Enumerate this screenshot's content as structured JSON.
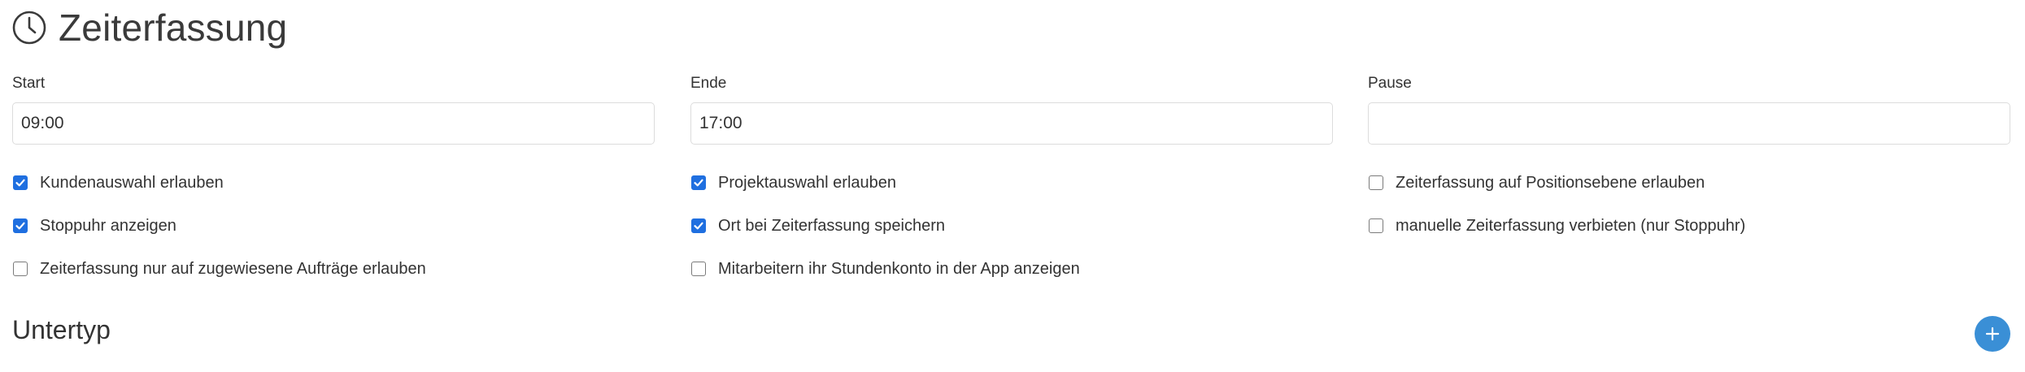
{
  "header": {
    "title": "Zeiterfassung",
    "icon": "clock-icon"
  },
  "fields": {
    "start": {
      "label": "Start",
      "value": "09:00"
    },
    "end": {
      "label": "Ende",
      "value": "17:00"
    },
    "pause": {
      "label": "Pause",
      "value": ""
    }
  },
  "options": [
    {
      "label": "Kundenauswahl erlauben",
      "checked": true
    },
    {
      "label": "Projektauswahl erlauben",
      "checked": true
    },
    {
      "label": "Zeiterfassung auf Positionsebene erlauben",
      "checked": false
    },
    {
      "label": "Stoppuhr anzeigen",
      "checked": true
    },
    {
      "label": "Ort bei Zeiterfassung speichern",
      "checked": true
    },
    {
      "label": "manuelle Zeiterfassung verbieten (nur Stoppuhr)",
      "checked": false
    },
    {
      "label": "Zeiterfassung nur auf zugewiesene Aufträge erlauben",
      "checked": false
    },
    {
      "label": "Mitarbeitern ihr Stundenkonto in der App anzeigen",
      "checked": false
    }
  ],
  "subtype": {
    "title": "Untertyp",
    "add_icon": "plus-icon"
  },
  "colors": {
    "checkbox_checked": "#1f6fe0",
    "add_button": "#3a8fd6"
  }
}
